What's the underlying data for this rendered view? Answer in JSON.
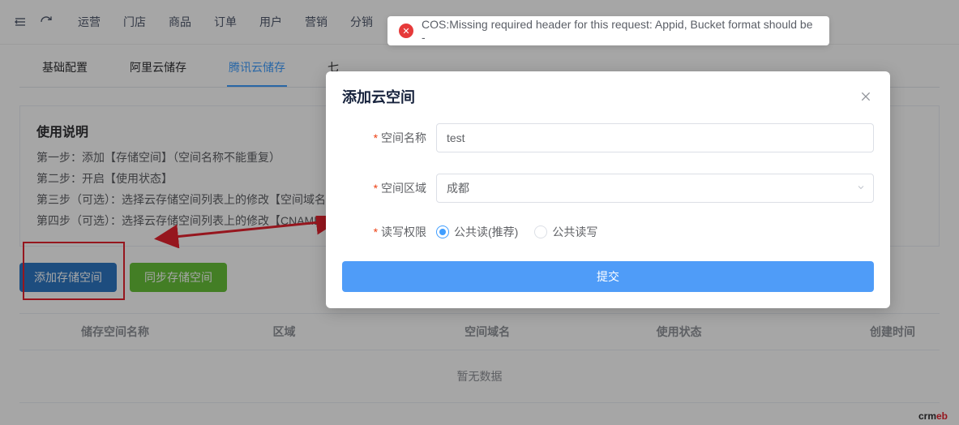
{
  "topnav": {
    "items": [
      "运营",
      "门店",
      "商品",
      "订单",
      "用户",
      "营销",
      "分销"
    ]
  },
  "toast": {
    "message": "COS:Missing required header for this request: Appid, Bucket format should be -"
  },
  "tabs": {
    "items": [
      "基础配置",
      "阿里云储存",
      "腾讯云储存",
      "七"
    ],
    "active_index": 2
  },
  "panel": {
    "title": "使用说明",
    "lines": [
      "第一步：添加【存储空间】（空间名称不能重复）",
      "第二步：开启【使用状态】",
      "第三步（可选）：选择云存储空间列表上的修改【空间域名",
      "第四步（可选）：选择云存储空间列表上的修改【CNAME"
    ]
  },
  "actions": {
    "add": "添加存储空间",
    "sync": "同步存储空间"
  },
  "table": {
    "headers": [
      "",
      "储存空间名称",
      "区域",
      "空间域名",
      "使用状态",
      "创建时间"
    ],
    "empty": "暂无数据"
  },
  "modal": {
    "title": "添加云空间",
    "fields": {
      "name": {
        "label": "空间名称",
        "value": "test"
      },
      "region": {
        "label": "空间区域",
        "value": "成都"
      },
      "acl": {
        "label": "读写权限",
        "options": [
          "公共读(推荐)",
          "公共读写"
        ],
        "selected_index": 0
      }
    },
    "submit": "提交"
  },
  "brand": {
    "left": "crm",
    "right": "eb"
  },
  "chart_data": null
}
